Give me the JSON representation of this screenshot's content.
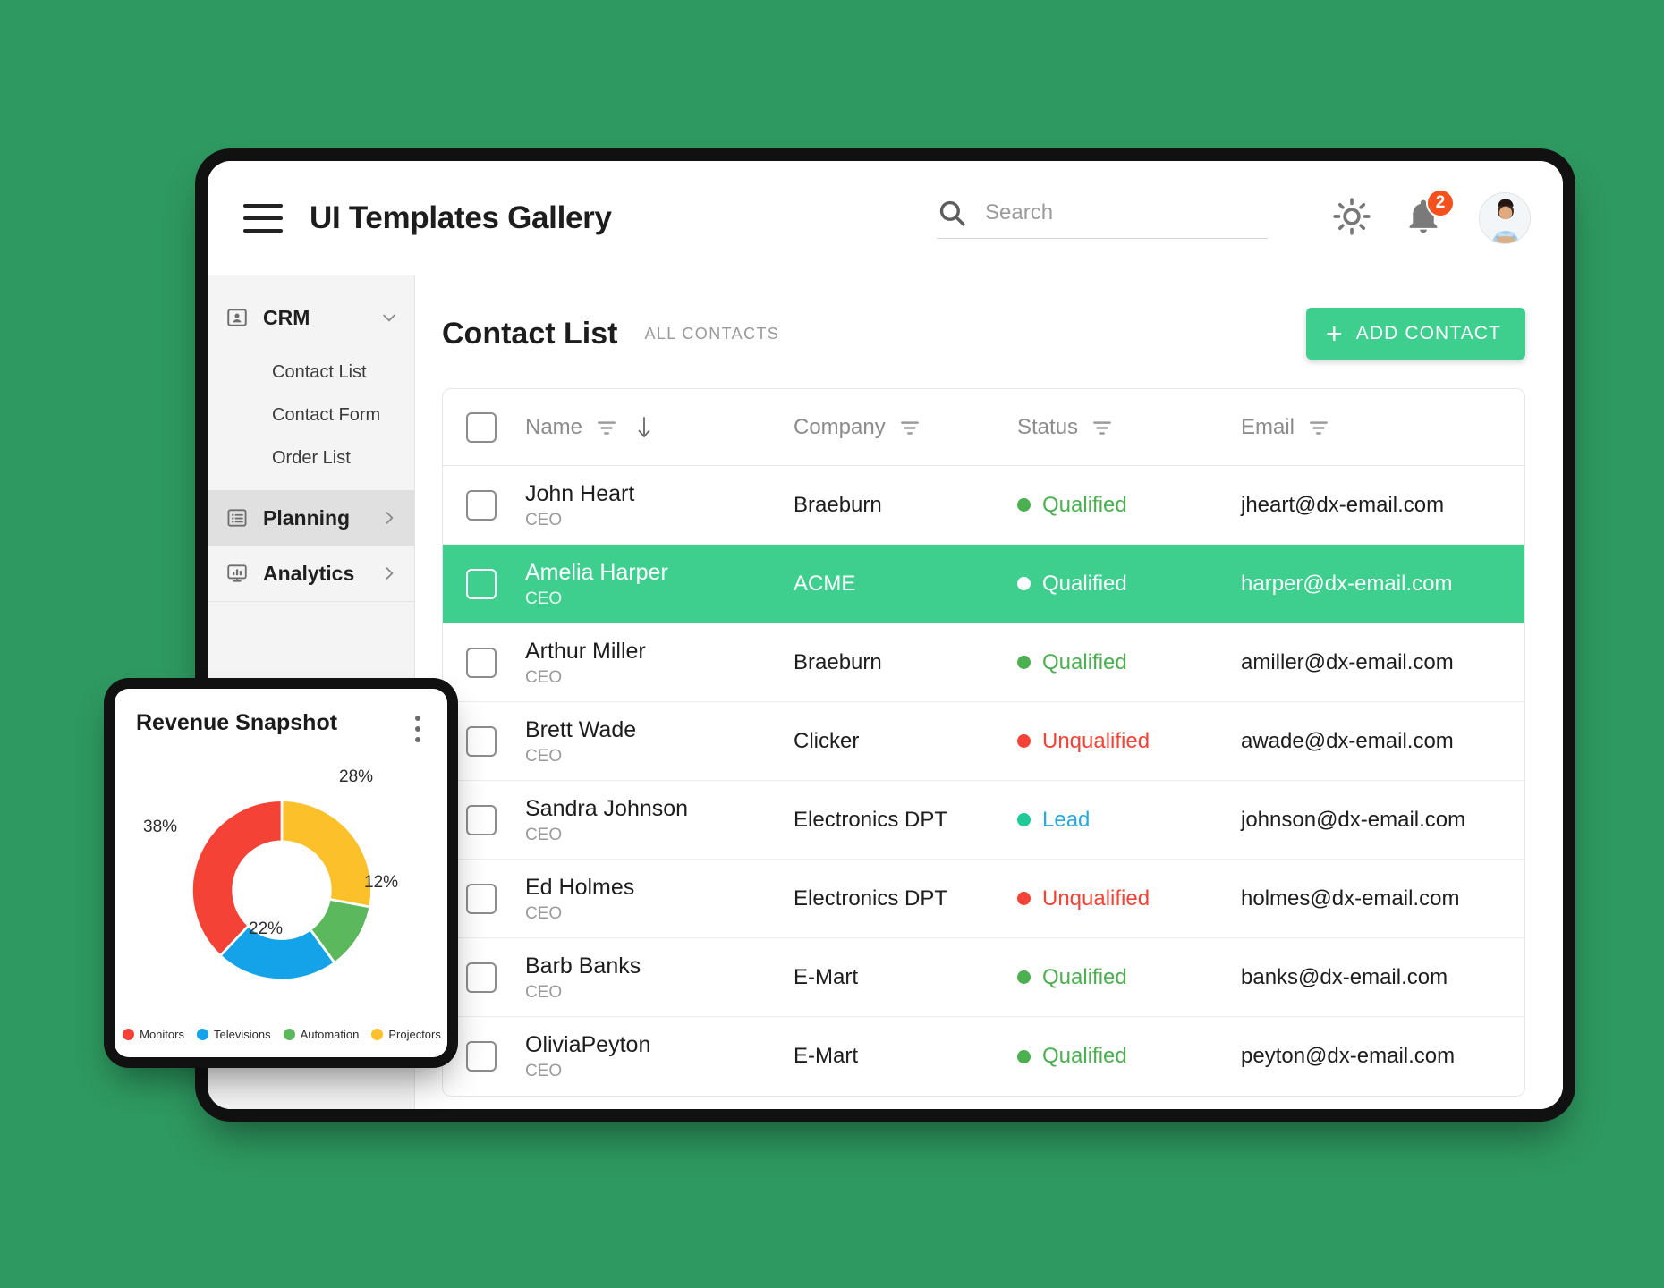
{
  "header": {
    "title": "UI Templates Gallery",
    "menu_icon": "hamburger-menu-icon",
    "search": {
      "placeholder": "Search",
      "value": "",
      "icon": "search-icon"
    },
    "theme_icon": "brightness-sun-icon",
    "notifications": {
      "icon": "bell-icon",
      "count": "2",
      "badge_color": "#f4511e"
    },
    "avatar": "user-avatar"
  },
  "sidebar": {
    "groups": [
      {
        "label": "CRM",
        "icon": "contact-card-icon",
        "chevron": "chevron-down-icon",
        "expanded": true,
        "active": false,
        "items": [
          {
            "label": "Contact List"
          },
          {
            "label": "Contact Form"
          },
          {
            "label": "Order List"
          }
        ]
      },
      {
        "label": "Planning",
        "icon": "list-icon",
        "chevron": "chevron-right-icon",
        "expanded": false,
        "active": true,
        "items": []
      },
      {
        "label": "Analytics",
        "icon": "monitor-chart-icon",
        "chevron": "chevron-right-icon",
        "expanded": false,
        "active": false,
        "items": []
      }
    ]
  },
  "main": {
    "page_title": "Contact List",
    "subtitle": "ALL CONTACTS",
    "add_button": {
      "label": "ADD CONTACT",
      "icon": "plus-icon",
      "color": "#3ecf8e"
    },
    "table": {
      "select_all_checkbox": false,
      "columns": [
        {
          "label": "Name",
          "filter_icon": "filter-icon",
          "sort_icon": "sort-descending-arrow-icon",
          "sorted": true
        },
        {
          "label": "Company",
          "filter_icon": "filter-icon",
          "sorted": false
        },
        {
          "label": "Status",
          "filter_icon": "filter-icon",
          "sorted": false
        },
        {
          "label": "Email",
          "filter_icon": "filter-icon",
          "sorted": false
        }
      ],
      "rows": [
        {
          "name": "John Heart",
          "role": "CEO",
          "company": "Braeburn",
          "status": "Qualified",
          "status_color": "#4caf50",
          "email": "jheart@dx-email.com",
          "selected": false,
          "checked": false
        },
        {
          "name": "Amelia Harper",
          "role": "CEO",
          "company": "ACME",
          "status": "Qualified",
          "status_color": "#ffffff",
          "email": "harper@dx-email.com",
          "selected": true,
          "checked": false
        },
        {
          "name": "Arthur Miller",
          "role": "CEO",
          "company": "Braeburn",
          "status": "Qualified",
          "status_color": "#4caf50",
          "email": "amiller@dx-email.com",
          "selected": false,
          "checked": false
        },
        {
          "name": "Brett Wade",
          "role": "CEO",
          "company": "Clicker",
          "status": "Unqualified",
          "status_color": "#f44336",
          "email": "awade@dx-email.com",
          "selected": false,
          "checked": false
        },
        {
          "name": "Sandra Johnson",
          "role": "CEO",
          "company": "Electronics DPT",
          "status": "Lead",
          "status_color": "#20c997",
          "status_text_color": "#29a8e0",
          "email": "johnson@dx-email.com",
          "selected": false,
          "checked": false
        },
        {
          "name": "Ed Holmes",
          "role": "CEO",
          "company": "Electronics DPT",
          "status": "Unqualified",
          "status_color": "#f44336",
          "email": "holmes@dx-email.com",
          "selected": false,
          "checked": false
        },
        {
          "name": "Barb Banks",
          "role": "CEO",
          "company": "E-Mart",
          "status": "Qualified",
          "status_color": "#4caf50",
          "email": "banks@dx-email.com",
          "selected": false,
          "checked": false
        },
        {
          "name": "OliviaPeyton",
          "role": "CEO",
          "company": "E-Mart",
          "status": "Qualified",
          "status_color": "#4caf50",
          "email": "peyton@dx-email.com",
          "selected": false,
          "checked": false
        }
      ]
    }
  },
  "snapshot": {
    "title": "Revenue Snapshot",
    "menu_icon": "kebab-menu-icon"
  },
  "chart_data": {
    "type": "pie",
    "variant": "donut",
    "title": "Revenue Snapshot",
    "categories": [
      "Monitors",
      "Televisions",
      "Automation",
      "Projectors"
    ],
    "values": [
      38,
      22,
      12,
      28
    ],
    "value_labels": [
      "38%",
      "22%",
      "12%",
      "28%"
    ],
    "colors": [
      "#f44336",
      "#14a2e8",
      "#5cb85c",
      "#fcc02a"
    ],
    "legend": [
      "Monitors",
      "Televisions",
      "Automation",
      "Projectors"
    ],
    "legend_position": "bottom",
    "units": "percent",
    "total": 100
  },
  "status_colors": {
    "qualified": "#4caf50",
    "unqualified": "#f44336",
    "lead_dot": "#20c997",
    "lead_text": "#29a8e0"
  }
}
